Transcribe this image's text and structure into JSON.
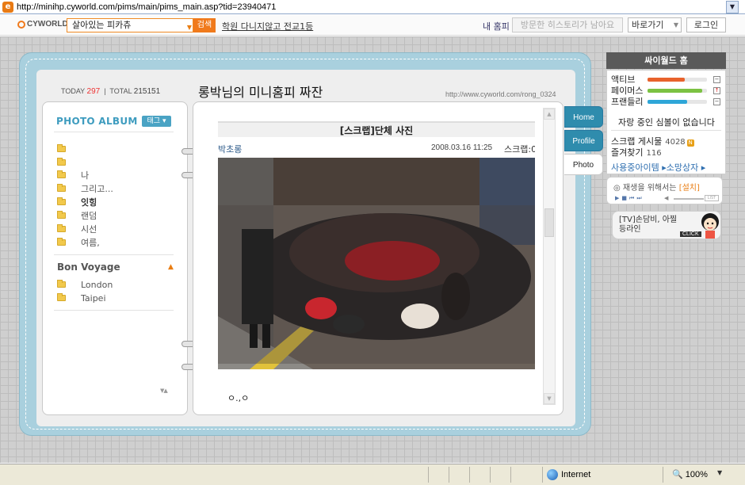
{
  "browser": {
    "url": "http://minihp.cyworld.com/pims/main/pims_main.asp?tid=23940471",
    "zone": "Internet",
    "zoom": "100%"
  },
  "cyworld_bar": {
    "logo": "CYWORLD",
    "search_value": "살아있는 피카츄",
    "search_button": "검색",
    "hot_link": "학원 다니지않고 전교1등",
    "my_home": "내 홈피",
    "history_button": "방문한 히스토리가 남아요",
    "shortcut_select": "바로가기",
    "login_button": "로그인"
  },
  "minihome": {
    "today_label": "TODAY",
    "today_count": "297",
    "total_label": "TOTAL",
    "total_count": "215151",
    "title": "롱박님의 미니홈피 짜잔",
    "url": "http://www.cyworld.com/rong_0324"
  },
  "photo_album": {
    "title": "PHOTO ALBUM",
    "tag_button": "태그",
    "folders": [
      "",
      "",
      "나",
      "그리고...",
      "잇힝",
      "랜덤",
      "시선",
      "여름,"
    ],
    "bold_folder_index": 4,
    "group_title": "Bon Voyage",
    "group_folders": [
      "London",
      "Taipei"
    ]
  },
  "post": {
    "title": "[스크랩]단체 사진",
    "author": "박초롱",
    "date": "2008.03.16 11:25",
    "scrap_label": "스크랩:0",
    "body": "ㅇ.,ㅇ"
  },
  "tabs": [
    "Home",
    "Profile",
    "Photo"
  ],
  "sidebar": {
    "header": "싸이월드 홈",
    "stats": [
      {
        "label": "액티브",
        "level": 0.62,
        "color": "#e8622c",
        "button": "−"
      },
      {
        "label": "페이머스",
        "level": 0.92,
        "color": "#7cc242",
        "button": "↑"
      },
      {
        "label": "프랜들리",
        "level": 0.66,
        "color": "#2ea6d8",
        "button": "−"
      }
    ],
    "no_guest_text": "자랑 중인 심볼이 없습니다",
    "scrap_label": "스크랩 게시물",
    "scrap_count": "4028",
    "scrap_badge": "N",
    "fav_label": "즐겨찾기",
    "fav_count": "116",
    "items_link": "사용중아이템 ▸",
    "wish_link": "소망상자 ▸"
  },
  "player": {
    "message": "재생을 위해서는",
    "install": "[설치]",
    "list_label": "LIST"
  },
  "ticker": {
    "text": "[TV]손담비, 아찔 등라인",
    "click": "CLICK"
  }
}
